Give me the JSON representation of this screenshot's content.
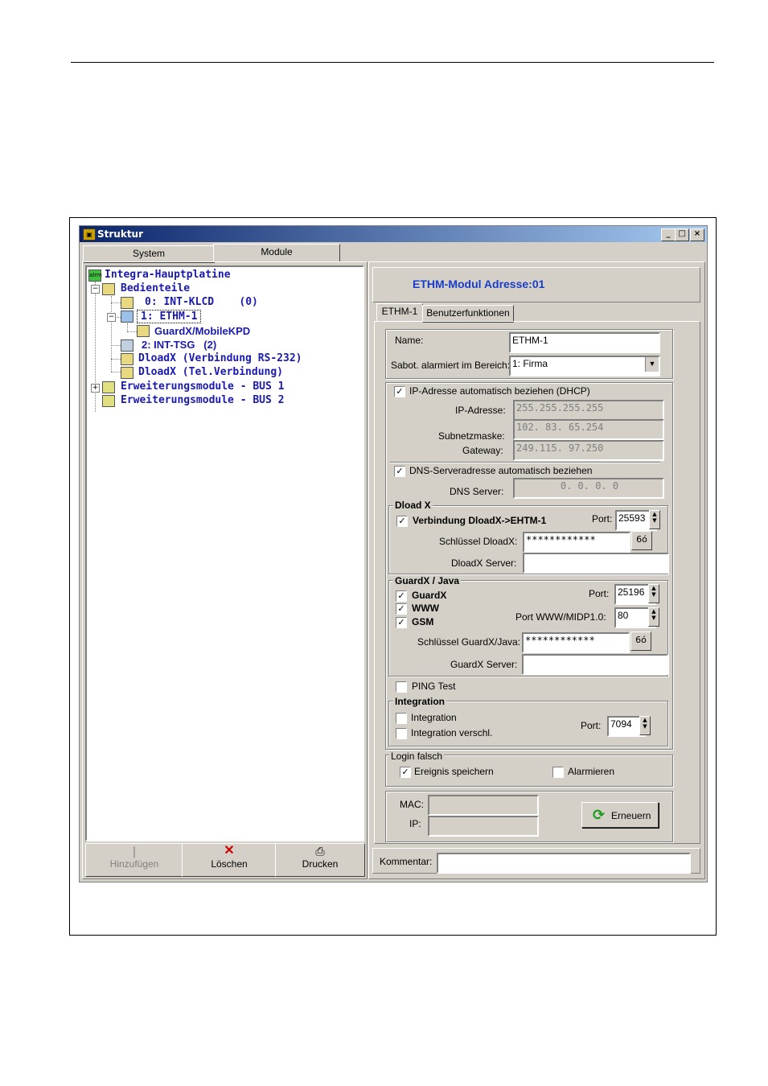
{
  "window": {
    "title": "Struktur"
  },
  "tabs": [
    "System",
    "Module"
  ],
  "tree": {
    "root": "Integra-Hauptplatine",
    "keypads": "Bedienteile",
    "kp0": "0: INT-KLCD    (0)",
    "kp1": "1: ETHM-1",
    "guardx": "GuardX/MobileKPD",
    "kp2": "2: INT-TSG   (2)",
    "dload1": "DloadX (Verbindung RS-232)",
    "dload2": "DloadX (Tel.Verbindung)",
    "bus1": "Erweiterungsmodule - BUS 1",
    "bus2": "Erweiterungsmodule - BUS 2"
  },
  "bottom_buttons": {
    "add": "Hinzufügen",
    "delete": "Löschen",
    "print": "Drucken"
  },
  "module": {
    "header": "ETHM-Modul Adresse:01",
    "tabs": [
      "ETHM-1",
      "Benutzerfunktionen"
    ],
    "name_label": "Name:",
    "name_value": "ETHM-1",
    "tamper_label": "Sabot. alarmiert im Bereich:",
    "tamper_value": "1: Firma",
    "dhcp_label": "IP-Adresse automatisch beziehen (DHCP)",
    "ip_label": "IP-Adresse:",
    "ip_value": "255.255.255.255",
    "mask_label": "Subnetzmaske:",
    "mask_value": "102. 83. 65.254",
    "gw_label": "Gateway:",
    "gw_value": "249.115. 97.250",
    "dns_auto_label": "DNS-Serveradresse automatisch beziehen",
    "dns_label": "DNS Server:",
    "dns_value": "0.   0.   0.   0",
    "dload_group": "Dload X",
    "dload_conn_label": "Verbindung DloadX->EHTM-1",
    "dload_port_label": "Port:",
    "dload_port_value": "25593",
    "dload_key_label": "Schlüssel DloadX:",
    "dload_key_value": "************",
    "dload_server_label": "DloadX Server:",
    "guard_group": "GuardX / Java",
    "guardx_label": "GuardX",
    "www_label": "WWW",
    "gsm_label": "GSM",
    "guard_port_label": "Port:",
    "guard_port_value": "25196",
    "www_port_label": "Port WWW/MIDP1.0:",
    "www_port_value": "80",
    "guard_key_label": "Schlüssel GuardX/Java:",
    "guard_key_value": "************",
    "guard_server_label": "GuardX Server:",
    "ping_label": "PING Test",
    "integ_group": "Integration",
    "integ_label": "Integration",
    "integ_enc_label": "Integration verschl.",
    "integ_port_label": "Port:",
    "integ_port_value": "7094",
    "login_group": "Login falsch",
    "event_label": "Ereignis speichern",
    "alarm_label": "Alarmieren",
    "mac_label": "MAC:",
    "ip2_label": "IP:",
    "renew_label": "Erneuern",
    "comment_label": "Kommentar:",
    "eye_glyph": "6ó"
  },
  "colors": {
    "titlebar": "#0a246a",
    "tree_text": "#1a1ab0",
    "face": "#d4d0c8"
  }
}
